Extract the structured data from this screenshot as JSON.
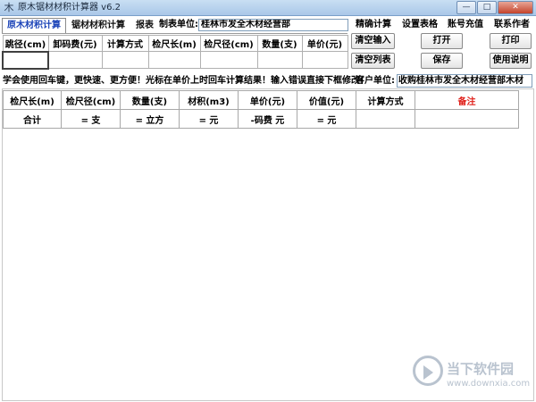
{
  "window": {
    "title": "原木锯材材积计算器 v6.2",
    "app_icon_glyph": "木",
    "min_glyph": "—",
    "max_glyph": "□",
    "close_glyph": "✕"
  },
  "tabs": [
    {
      "label": "原木材积计算",
      "active": true
    },
    {
      "label": "锯材材积计算",
      "active": false
    },
    {
      "label": "报表",
      "active": false
    }
  ],
  "header": {
    "unit_label": "制表单位:",
    "unit_value": "桂林市发全木材经营部"
  },
  "menu": [
    "精确计算",
    "设置表格",
    "账号充值",
    "联系作者"
  ],
  "input_grid": {
    "columns": [
      "跳径(cm)",
      "卸码费(元)",
      "计算方式",
      "检尺长(m)",
      "检尺径(cm)",
      "数量(支)",
      "单价(元)"
    ],
    "values": [
      "",
      "",
      "",
      "",
      "",
      "",
      ""
    ]
  },
  "buttons": {
    "clear_input": "清空输入",
    "clear_list": "清空列表",
    "open": "打开",
    "save": "保存",
    "print": "打印",
    "help": "使用说明"
  },
  "hint": {
    "text": "学会使用回车键，更快速、更方便！光标在单价上时回车计算结果！输入错误直接下框修改!",
    "client_label": "客户单位:",
    "client_value": "收购桂林市发全木材经营部木材"
  },
  "result_grid": {
    "headers": [
      "检尺长(m)",
      "检尺径(cm)",
      "数量(支)",
      "材积(m3)",
      "单价(元)",
      "价值(元)",
      "计算方式",
      "备注"
    ],
    "total_row": [
      "合计",
      "= 支",
      "= 立方",
      "= 元",
      "-码费 元",
      "= 元",
      "",
      ""
    ]
  },
  "watermark": {
    "text": "当下软件园",
    "url": "www.downxia.com"
  },
  "colors": {
    "active_tab": "#1c44b8",
    "remark_header": "#e0201a",
    "titlebar": "#a9c7e8"
  }
}
